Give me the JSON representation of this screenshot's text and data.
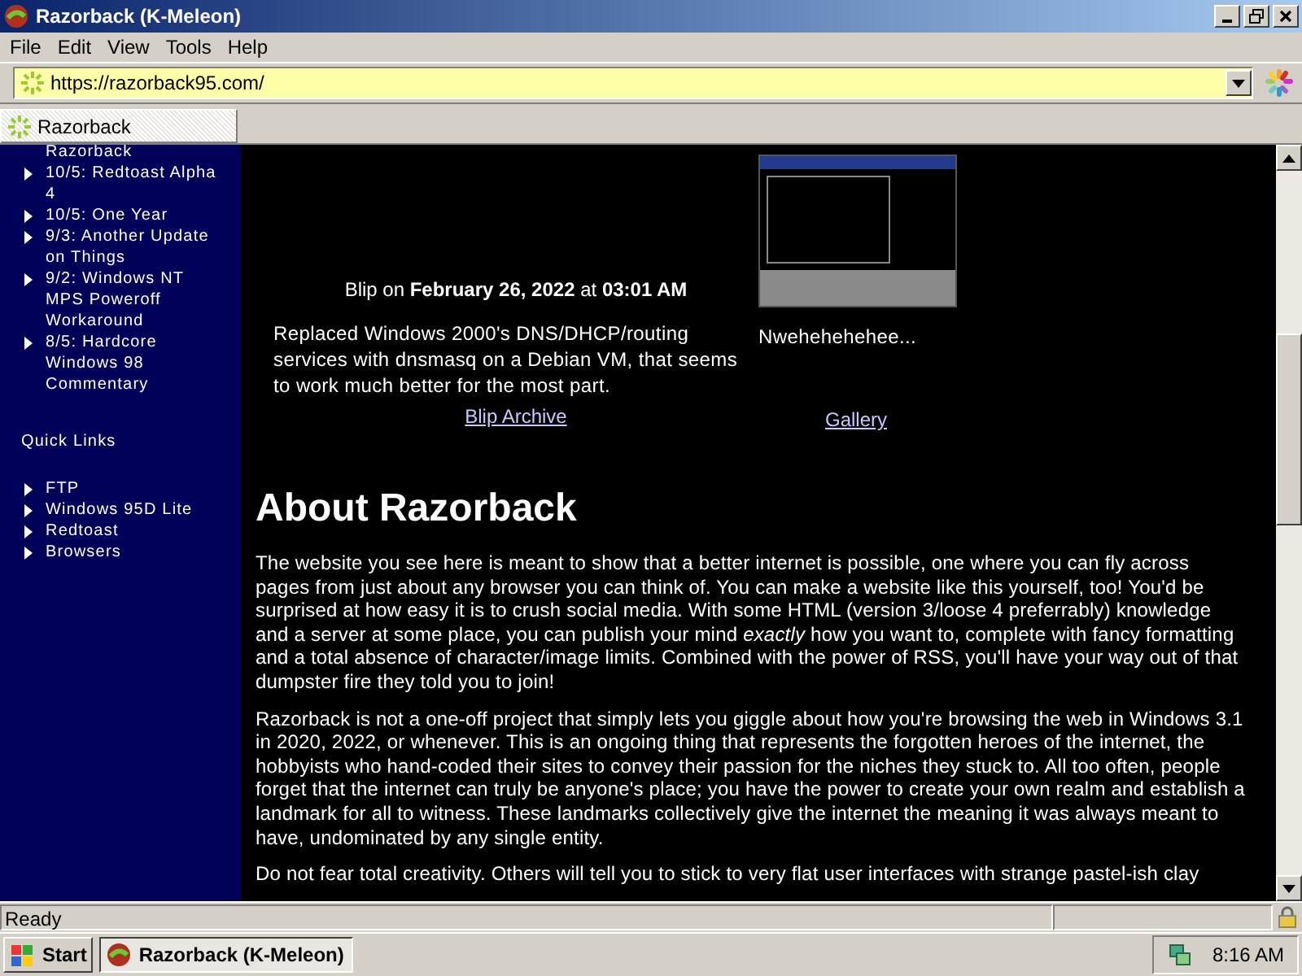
{
  "window": {
    "title": "Razorback (K-Meleon)"
  },
  "menu": [
    "File",
    "Edit",
    "View",
    "Tools",
    "Help"
  ],
  "address": {
    "url": "https://razorback95.com/"
  },
  "tabs": [
    {
      "label": "Razorback",
      "selected": true
    }
  ],
  "sidebar": {
    "cut_item": "Razorback",
    "posts": [
      "10/5: Redtoast Alpha 4",
      "10/5: One Year",
      "9/3: Another Update on Things",
      "9/2: Windows NT MPS Poweroff Workaround",
      "8/5: Hardcore Windows 98 Commentary"
    ],
    "quick_links_heading": "Quick Links",
    "quick_links": [
      "FTP",
      "Windows 95D Lite",
      "Redtoast",
      "Browsers"
    ]
  },
  "blip": {
    "heading": "Blip on **February 26, 2022** at **03:01 AM**",
    "text": "Replaced Windows 2000's DNS/DHCP/routing services with dnsmasq on a Debian VM, that seems to work much better for the most part.",
    "link": "Blip Archive"
  },
  "gallery": {
    "caption": "Nwehehehehee...",
    "link": "Gallery"
  },
  "about": {
    "heading": "About Razorback",
    "paragraphs": [
      "The website you see here is meant to show that a better internet is possible, one where you can fly across pages from just about any browser you can think of. You can make a website like this yourself, too! You'd be surprised at how easy it is to crush social media. With some HTML (version 3/loose 4 preferrably) knowledge and a server at some place, you can publish your mind *exactly* how you want to, complete with fancy formatting and a total absence of character/image limits. Combined with the power of RSS, you'll have your way out of that dumpster fire they told you to join!",
      "Razorback is not a one-off project that simply lets you giggle about how you're browsing the web in Windows 3.1 in 2020, 2022, or whenever. This is an ongoing thing that represents the forgotten heroes of the internet, the hobbyists who hand-coded their sites to convey their passion for the niches they stuck to. All too often, people forget that the internet can truly be anyone's place; you have the power to create your own realm and establish a landmark for all to witness. These landmarks collectively give the internet the meaning it was always meant to have, undominated by any single entity.",
      "Do not fear total creativity. Others will tell you to stick to very flat user interfaces with strange pastel-ish clay"
    ]
  },
  "status": "Ready",
  "taskbar": {
    "start": "Start",
    "task": "Razorback (K-Meleon)",
    "clock": "8:16 AM"
  }
}
